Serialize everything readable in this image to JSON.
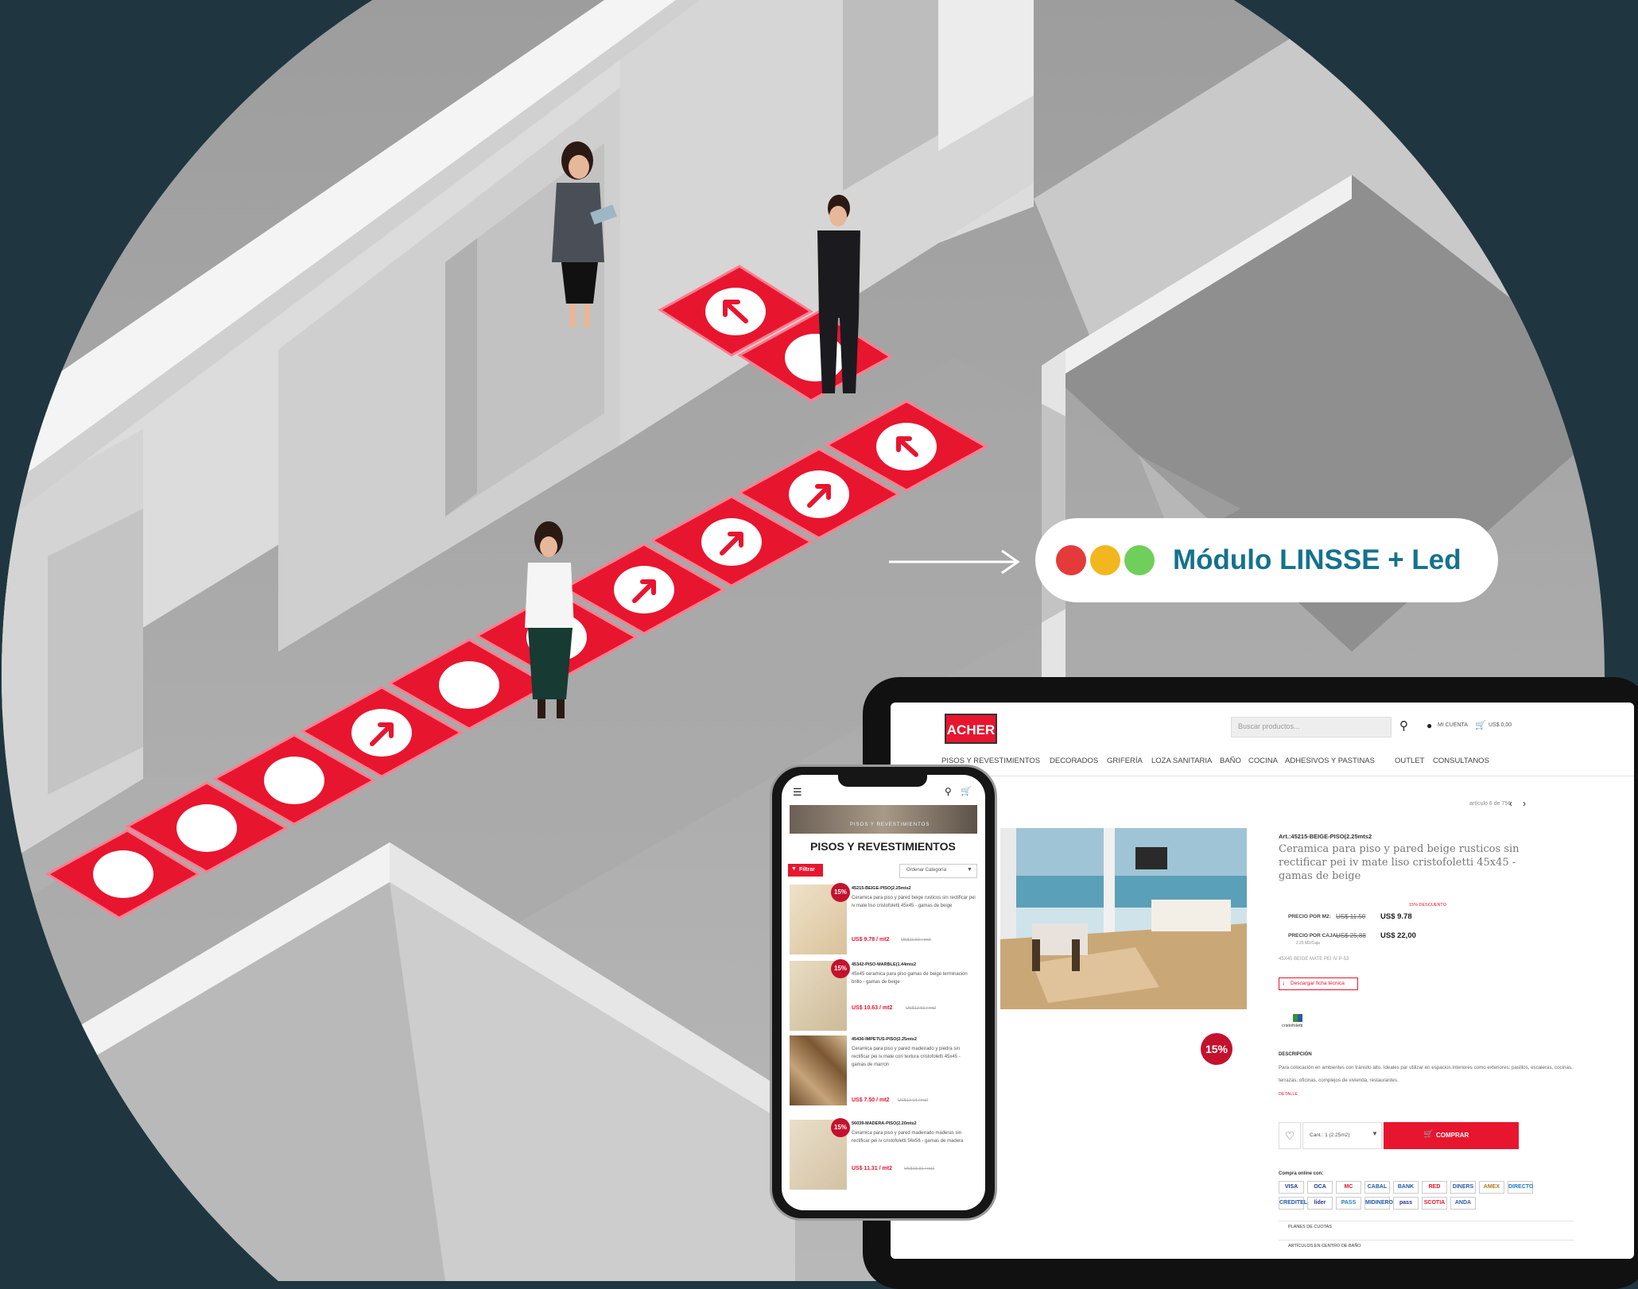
{
  "callout": {
    "label": "Módulo LINSSE + Led",
    "dots": [
      "#e53a3a",
      "#f2b71f",
      "#6fcf5a"
    ],
    "text_color": "#14728f"
  },
  "colors": {
    "background": "#1f3640",
    "brand_red": "#e8152f",
    "floor_gray": "#bfbfbf"
  },
  "tablet": {
    "logo": "ACHER",
    "search": {
      "placeholder": "Buscar productos...",
      "icon": "search-icon"
    },
    "account_label": "MI CUENTA",
    "cart_label": "US$ 0,00",
    "nav": [
      "PISOS Y REVESTIMIENTOS",
      "DECORADOS",
      "GRIFERÍA",
      "LOZA SANITARIA",
      "BAÑO",
      "COCINA",
      "ADHESIVOS Y PASTINAS",
      "OUTLET",
      "CONSULTANOS"
    ],
    "pager": "artículo 6 de 756",
    "product": {
      "sku": "Art.:45215-BEIGE-PISO(2.25mts2",
      "title": "Ceramica para piso y pared beige rusticos sin rectificar pei iv mate liso cristofoletti 45x45 - gamas de beige",
      "discount_note": "15% DESCUENTO",
      "price_m2_label": "PRECIO POR M2:",
      "price_m2_old": "US$ 11.50",
      "price_m2_new": "US$ 9.78",
      "price_box_label": "PRECIO POR CAJA:",
      "price_box_note": "2.25 M2/Caja",
      "price_box_old": "US$ 25,88",
      "price_box_new": "US$ 22,00",
      "code_line": "45X45 BEIGE MATE PEI IV P-53",
      "download_label": "Descargar ficha técnica",
      "brand": "cristofoletti",
      "description_title": "DESCRIPCIÓN",
      "description": "Para colocación en ambientes con tránsito alto. Ideales par utilizar en espacios interiores como exteriores: pasillos, escaleras, cocinas, terrazas, oficinas, complejos de vivienda, restaurantes.",
      "more": "DETALLE",
      "badge": "15%",
      "qty_label": "Cant.: 1 (2.25m2)",
      "buy_label": "COMPRAR",
      "pay_title": "Compra online con:",
      "pay_methods": [
        "VISA",
        "OCA",
        "MC",
        "CABAL",
        "BANK",
        "RED",
        "DINERS",
        "AMEX",
        "DIRECTO",
        "CREDITEL",
        "lider",
        "PASS",
        "MIDINERO",
        "pass",
        "SCOTIA",
        "ANDA"
      ],
      "accordion": [
        "PLANES DE CUOTAS",
        "ARTÍCULOS EN CENTRO DE BAÑO"
      ]
    }
  },
  "phone": {
    "banner": "PISOS Y REVESTIMIENTOS",
    "title": "PISOS Y REVESTIMIENTOS",
    "filter_label": "Filtrar",
    "order_label": "Ordenar Categoría",
    "items": [
      {
        "sku": "45215-BEIGE-PISO(2.25mts2",
        "name": "Ceramica para piso y pared beige rusticos sin rectificar pei iv mate liso cristofoletti 45x45 - gamas de beige",
        "price": "US$ 9.78 / mt2",
        "old": "US$11.50 / mt2",
        "badge": "15%"
      },
      {
        "sku": "45342-PISO-MARBLE(1.44mts2",
        "name": "45x45 ceramica para piso gamas de beige terminacion brillo - gamas de beige",
        "price": "US$ 10.63 / mt2",
        "old": "US$12.51 / mt2",
        "badge": "15%"
      },
      {
        "sku": "45436-IMPETUS-PISO(2.25mts2",
        "name": "Ceramica para piso y pared madeirado y piedra sin rectificar pei iv mate con textura cristofoletti 45x45 - gamas de marron",
        "price": "US$ 7.50 / mt2",
        "old": "US$12.04 / mt2",
        "badge": ""
      },
      {
        "sku": "56039-MADERA-PISO(2.20mts2",
        "name": "Ceramica para piso y pared madeirado maderas sin rectificar pei iv cristofoletti 56x56 - gamas de madera",
        "price": "US$ 11.31 / mt2",
        "old": "US$13.31 / mt2",
        "badge": "15%"
      }
    ]
  }
}
